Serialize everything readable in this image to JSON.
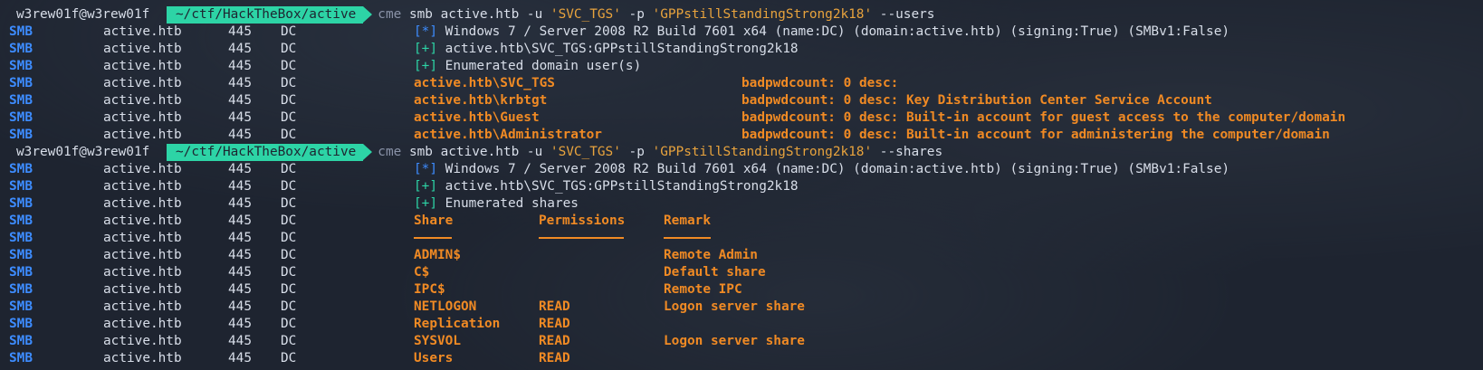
{
  "prompt": {
    "user": "w3rew01f@w3rew01f",
    "path": "~/ctf/HackTheBox/active",
    "cmd_name": "cme",
    "cmd_users_pre": "smb active.htb -u ",
    "cmd_user": "'SVC_TGS'",
    "cmd_mid": " -p ",
    "cmd_pass": "'GPPstillStandingStrong2k18'",
    "cmd_users_post": " --users",
    "cmd_shares_post": " --shares"
  },
  "row": {
    "proto": "SMB",
    "host": "active.htb",
    "port": "445",
    "name": "DC"
  },
  "info": {
    "star_mark": "[*]",
    "plus_mark": "[+]",
    "os": "Windows 7 / Server 2008 R2 Build 7601 x64 (name:DC) (domain:active.htb) (signing:True) (SMBv1:False)",
    "auth": "active.htb\\SVC_TGS:GPPstillStandingStrong2k18",
    "enum_users": "Enumerated domain user(s)",
    "enum_shares": "Enumerated shares"
  },
  "users": [
    {
      "name": "active.htb\\SVC_TGS",
      "desc": "badpwdcount: 0 desc:"
    },
    {
      "name": "active.htb\\krbtgt",
      "desc": "badpwdcount: 0 desc: Key Distribution Center Service Account"
    },
    {
      "name": "active.htb\\Guest",
      "desc": "badpwdcount: 0 desc: Built-in account for guest access to the computer/domain"
    },
    {
      "name": "active.htb\\Administrator",
      "desc": "badpwdcount: 0 desc: Built-in account for administering the computer/domain"
    }
  ],
  "shares_header": {
    "share": "Share",
    "perm": "Permissions",
    "remark": "Remark"
  },
  "shares": [
    {
      "share": "ADMIN$",
      "perm": "",
      "remark": "Remote Admin"
    },
    {
      "share": "C$",
      "perm": "",
      "remark": "Default share"
    },
    {
      "share": "IPC$",
      "perm": "",
      "remark": "Remote IPC"
    },
    {
      "share": "NETLOGON",
      "perm": "READ",
      "remark": "Logon server share"
    },
    {
      "share": "Replication",
      "perm": "READ",
      "remark": ""
    },
    {
      "share": "SYSVOL",
      "perm": "READ",
      "remark": "Logon server share"
    },
    {
      "share": "Users",
      "perm": "READ",
      "remark": ""
    }
  ],
  "colors": {
    "background": "#1e2430",
    "prompt_path_bg": "#2dd4a6",
    "proto": "#3d8cff",
    "highlight": "#f08a24"
  }
}
